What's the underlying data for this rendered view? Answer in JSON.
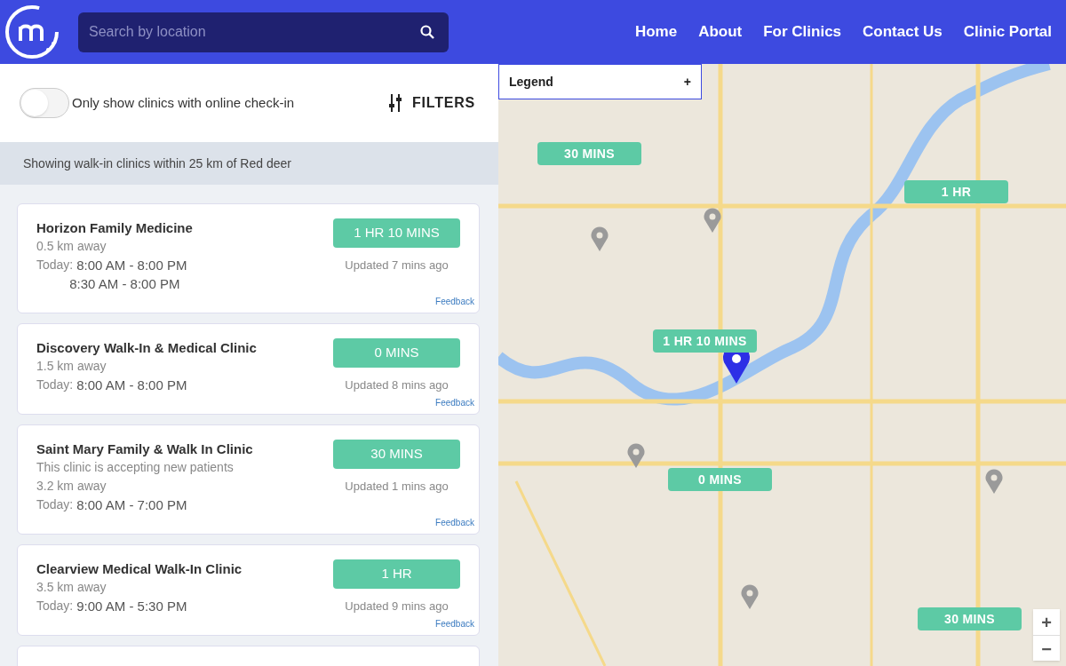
{
  "header": {
    "search": {
      "placeholder": "Search by location"
    },
    "nav": [
      "Home",
      "About",
      "For Clinics",
      "Contact Us",
      "Clinic Portal"
    ]
  },
  "toolbar": {
    "toggle": {
      "label": "Only show clinics with online check-in",
      "on": false
    },
    "filters": "FILTERS"
  },
  "summary": "Showing walk-in clinics within 25 km of Red deer",
  "clinics": [
    {
      "name": "Horizon Family Medicine",
      "distance": "0.5 km away",
      "hours_label": "Today:",
      "hours": [
        "8:00 AM - 8:00 PM",
        "8:30 AM - 8:00 PM"
      ],
      "wait": "1 HR 10 MINS",
      "updated": "Updated 7 mins ago",
      "feedback": "Feedback"
    },
    {
      "name": "Discovery Walk-In & Medical Clinic",
      "distance": "1.5 km away",
      "hours_label": "Today:",
      "hours": [
        "8:00 AM - 8:00 PM"
      ],
      "wait": "0 MINS",
      "updated": "Updated 8 mins ago",
      "feedback": "Feedback"
    },
    {
      "name": "Saint Mary Family & Walk In Clinic",
      "note": "This clinic is accepting new patients",
      "distance": "3.2 km away",
      "hours_label": "Today:",
      "hours": [
        "8:00 AM - 7:00 PM"
      ],
      "wait": "30 MINS",
      "updated": "Updated 1 mins ago",
      "feedback": "Feedback"
    },
    {
      "name": "Clearview Medical Walk-In Clinic",
      "distance": "3.5 km away",
      "hours_label": "Today:",
      "hours": [
        "9:00 AM - 5:30 PM"
      ],
      "wait": "1 HR",
      "updated": "Updated 9 mins ago",
      "feedback": "Feedback"
    }
  ],
  "map": {
    "legend": {
      "label": "Legend",
      "toggle": "+"
    },
    "wait_pins": [
      "30 MINS",
      "1 HR",
      "1 HR 10 MINS",
      "0 MINS",
      "30 MINS"
    ],
    "zoom": [
      "+",
      "−"
    ]
  }
}
